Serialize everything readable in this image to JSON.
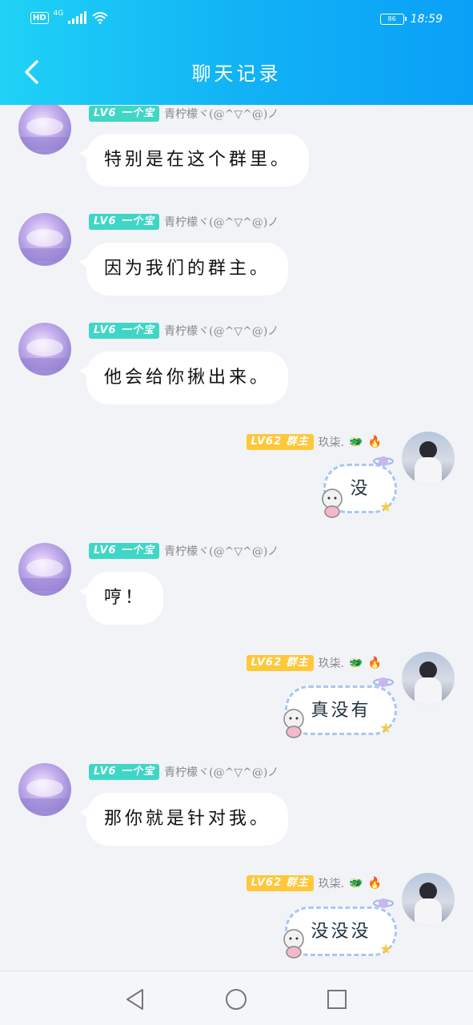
{
  "status_bar": {
    "hd": "HD",
    "network": "4G",
    "battery": "86",
    "time": "18:59"
  },
  "header": {
    "title": "聊天记录"
  },
  "messages": [
    {
      "side": "left",
      "badge": "LV6 一个宝",
      "nick": "青柠檬ヾ(@^▽^@)ノ",
      "text": "特别是在这个群里。"
    },
    {
      "side": "left",
      "badge": "LV6 一个宝",
      "nick": "青柠檬ヾ(@^▽^@)ノ",
      "text": "因为我们的群主。"
    },
    {
      "side": "left",
      "badge": "LV6 一个宝",
      "nick": "青柠檬ヾ(@^▽^@)ノ",
      "text": "他会给你揪出来。"
    },
    {
      "side": "right",
      "badge": "LV62 群主",
      "nick": "玖柒.",
      "text": "没"
    },
    {
      "side": "left",
      "badge": "LV6 一个宝",
      "nick": "青柠檬ヾ(@^▽^@)ノ",
      "text": "哼！"
    },
    {
      "side": "right",
      "badge": "LV62 群主",
      "nick": "玖柒.",
      "text": "真没有"
    },
    {
      "side": "left",
      "badge": "LV6 一个宝",
      "nick": "青柠檬ヾ(@^▽^@)ノ",
      "text": "那你就是针对我。"
    },
    {
      "side": "right",
      "badge": "LV62 群主",
      "nick": "玖柒.",
      "text": "没没没"
    }
  ],
  "nav": {
    "icons": [
      "back-triangle-icon",
      "home-circle-icon",
      "recents-square-icon"
    ]
  },
  "colors": {
    "header_start": "#1fd2f6",
    "header_end": "#0aa0f7",
    "badge_member": "#3fd6c6",
    "badge_owner": "#ffc83a",
    "bg": "#f2f3f7"
  }
}
